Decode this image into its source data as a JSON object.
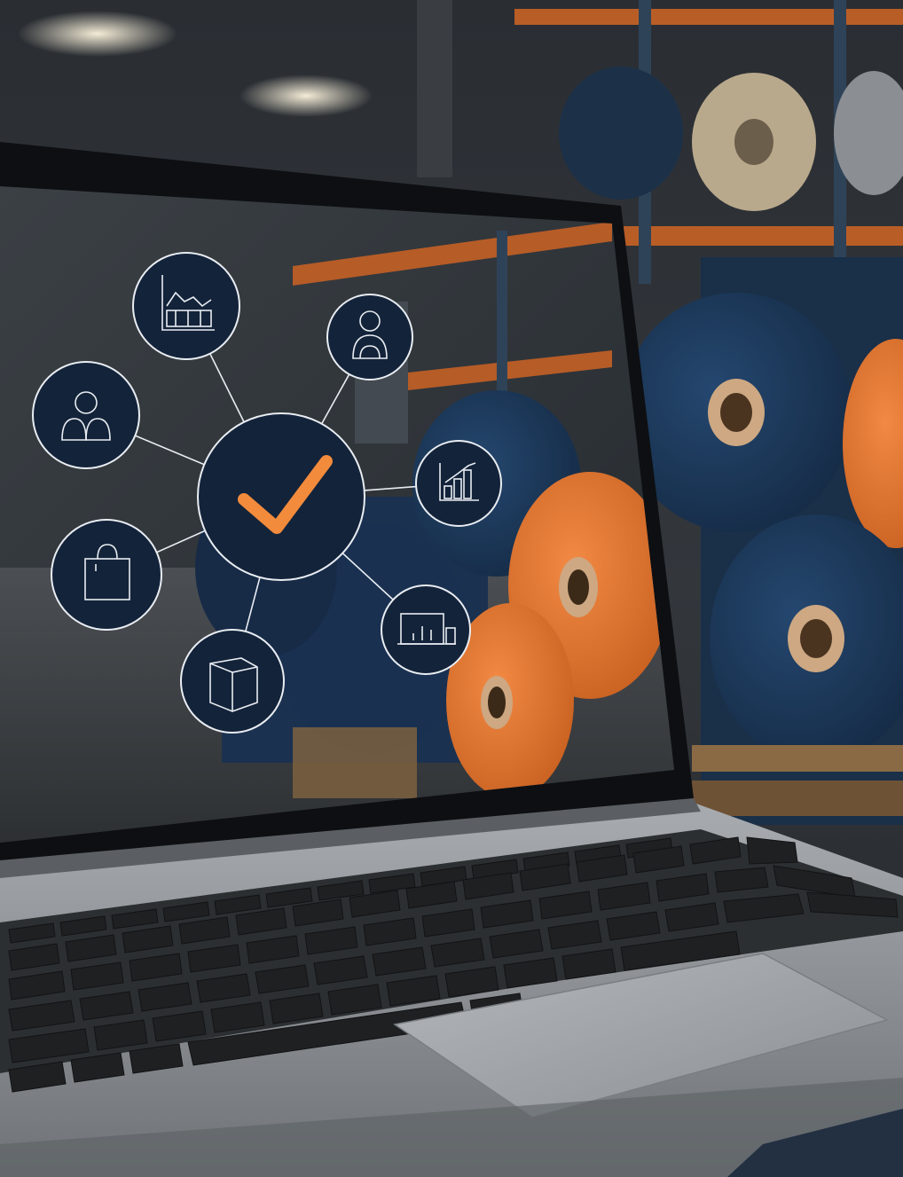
{
  "scene": {
    "subject": "laptop-with-network-overlay",
    "background": "textile-warehouse",
    "colors": {
      "navy": "#1e3a5f",
      "navy_dark": "#12263f",
      "orange": "#ee7a33",
      "orange_dark": "#c8601e",
      "core": "#cda882",
      "shelf_orange": "#c4622a",
      "node_fill": "#13233a",
      "node_stroke": "#e9edf2",
      "line": "#e9edf2",
      "check": "#f28b3c",
      "laptop_silver": "#8f9397",
      "key": "#1e2022",
      "bezel": "#0d0f12"
    }
  },
  "network": {
    "center": {
      "icon": "checkmark-icon"
    },
    "nodes": [
      {
        "id": "analytics",
        "icon": "analytics-chart-icon"
      },
      {
        "id": "person",
        "icon": "person-icon"
      },
      {
        "id": "team",
        "icon": "team-icon"
      },
      {
        "id": "growth",
        "icon": "growth-chart-icon"
      },
      {
        "id": "shopping",
        "icon": "shopping-bag-icon"
      },
      {
        "id": "dashboard",
        "icon": "dashboard-icon"
      },
      {
        "id": "package",
        "icon": "package-box-icon"
      }
    ]
  }
}
